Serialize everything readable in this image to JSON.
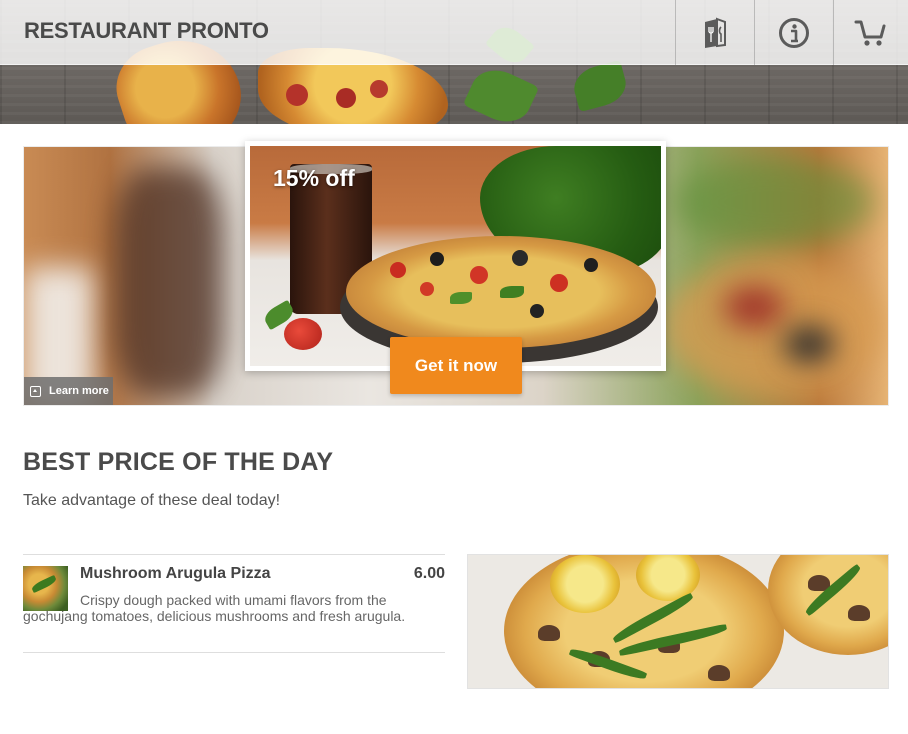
{
  "header": {
    "brand": "RESTAURANT PRONTO",
    "nav": [
      {
        "icon": "menu-book-icon"
      },
      {
        "icon": "info-icon"
      },
      {
        "icon": "cart-icon"
      }
    ]
  },
  "promo": {
    "discount_label": "15% off",
    "cta_label": "Get it now",
    "learn_more_label": "Learn more"
  },
  "section": {
    "title": "BEST PRICE OF THE DAY",
    "subtitle": "Take advantage of these deal today!"
  },
  "items": [
    {
      "name": "Mushroom Arugula Pizza",
      "price": "6.00",
      "description": "Crispy dough packed with umami flavors from the gochujang tomatoes, delicious mushrooms and fresh arugula."
    }
  ],
  "colors": {
    "accent": "#f0891d",
    "text_dark": "#4a4a4a"
  }
}
